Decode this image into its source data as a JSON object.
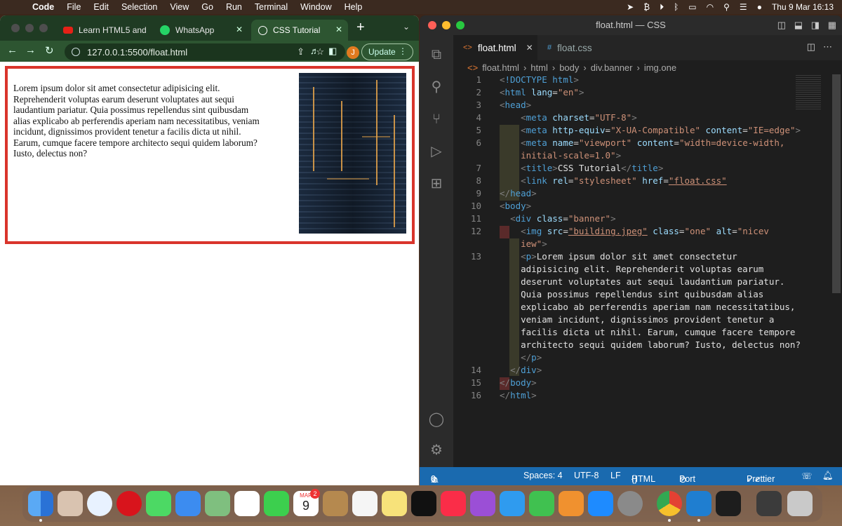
{
  "menubar": {
    "app": "Code",
    "items": [
      "File",
      "Edit",
      "Selection",
      "View",
      "Go",
      "Run",
      "Terminal",
      "Window",
      "Help"
    ],
    "datetime": "Thu 9 Mar  16:13"
  },
  "chrome": {
    "tabs": [
      {
        "label": "Learn HTML5 and",
        "icon": "youtube-icon"
      },
      {
        "label": "WhatsApp",
        "icon": "whatsapp-icon"
      },
      {
        "label": "CSS Tutorial",
        "icon": "globe-icon",
        "active": true
      }
    ],
    "new_tab": "+",
    "url": "127.0.0.1:5500/float.html",
    "avatar_initial": "J",
    "update_label": "Update",
    "page_text": "Lorem ipsum dolor sit amet consectetur adipisicing elit. Reprehenderit voluptas earum deserunt voluptates aut sequi laudantium pariatur. Quia possimus repellendus sint quibusdam alias explicabo ab perferendis aperiam nam necessitatibus, veniam incidunt, dignissimos provident tenetur a facilis dicta ut nihil. Earum, cumque facere tempore architecto sequi quidem laborum? Iusto, delectus non?"
  },
  "vscode": {
    "title": "float.html — CSS",
    "tabs": [
      {
        "label": "float.html",
        "icon": "<>",
        "active": true
      },
      {
        "label": "float.css",
        "icon": "#"
      }
    ],
    "breadcrumb": [
      "float.html",
      "html",
      "body",
      "div.banner",
      "img.one"
    ],
    "line_numbers": [
      "1",
      "2",
      "3",
      "4",
      "5",
      "6",
      "",
      "7",
      "8",
      "9",
      "10",
      "11",
      "12",
      "",
      "13",
      "",
      "",
      "",
      "",
      "",
      "",
      "",
      "",
      "14",
      "15",
      "16"
    ],
    "status": {
      "errors": "0",
      "warnings": "0",
      "spaces": "Spaces: 4",
      "encoding": "UTF-8",
      "eol": "LF",
      "language": "HTML",
      "port": "Port : 5500",
      "formatter": "Prettier"
    }
  },
  "dock": {
    "calendar_month": "MAR",
    "calendar_day": "9",
    "calendar_badge": "2"
  }
}
